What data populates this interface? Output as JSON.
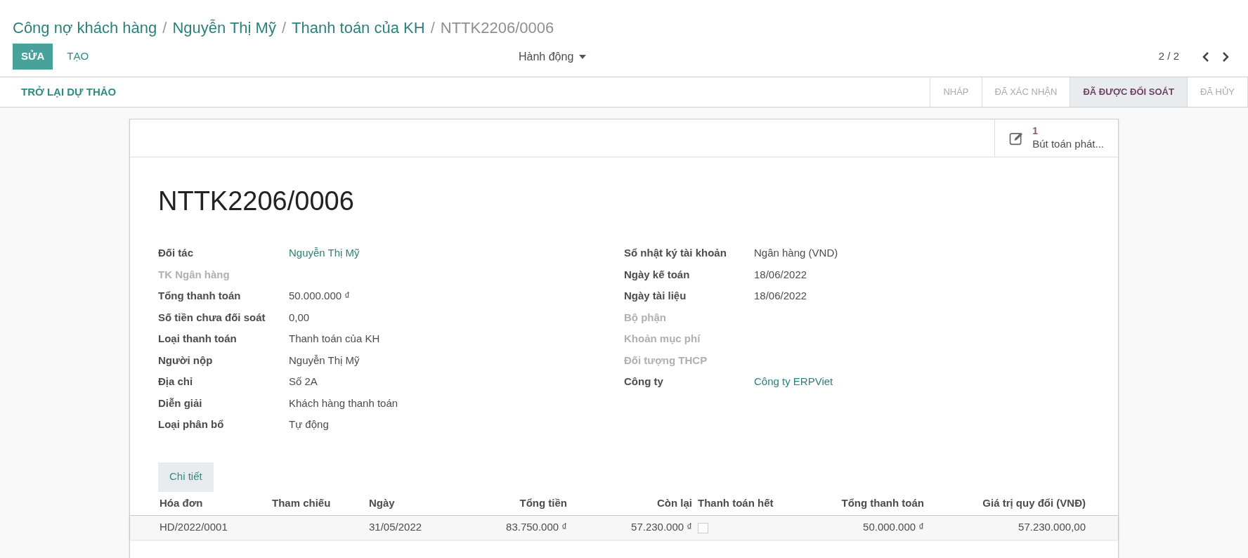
{
  "breadcrumbs": [
    {
      "label": "Công nợ khách hàng",
      "current": false
    },
    {
      "label": "Nguyễn Thị Mỹ",
      "current": false
    },
    {
      "label": "Thanh toán của KH",
      "current": false
    },
    {
      "label": "NTTK2206/0006",
      "current": true
    }
  ],
  "breadcrumb_separator": "/",
  "toolbar": {
    "edit_button": "SỬA",
    "create_button": "TẠO",
    "action_menu": "Hành động",
    "pager": "2 / 2"
  },
  "header": {
    "button": "TRỞ LẠI DỰ THẢO",
    "stages": [
      {
        "label": "NHÁP",
        "selected": false
      },
      {
        "label": "ĐÃ XÁC NHẬN",
        "selected": false
      },
      {
        "label": "ĐÃ ĐƯỢC ĐỐI SOÁT",
        "selected": true
      },
      {
        "label": "ĐÃ HỦY",
        "selected": false
      }
    ]
  },
  "smart_button": {
    "count": "1",
    "label": "Bút toán phát..."
  },
  "title": "NTTK2206/0006",
  "left_fields": [
    {
      "label": "Đối tác",
      "value": "Nguyễn Thị Mỹ",
      "muted": false,
      "link": true
    },
    {
      "label": "TK Ngân hàng",
      "muted": true,
      "link": false
    },
    {
      "label": "Tổng thanh toán",
      "value": "50.000.000 ₫",
      "muted": false,
      "link": false
    },
    {
      "label": "Số tiền chưa đối soát",
      "value": "0,00",
      "muted": false,
      "link": false
    },
    {
      "label": "Loại thanh toán",
      "value": "Thanh toán của KH",
      "muted": false,
      "link": false
    },
    {
      "label": "Người nộp",
      "value": "Nguyễn Thị Mỹ",
      "muted": false,
      "link": false
    },
    {
      "label": "Địa chỉ",
      "value": "Số 2A",
      "muted": false,
      "link": false
    },
    {
      "label": "Diễn giải",
      "value": "Khách hàng thanh toán",
      "muted": false,
      "link": false
    },
    {
      "label": "Loại phân bổ",
      "value": "Tự động",
      "muted": false,
      "link": false
    }
  ],
  "right_fields": [
    {
      "label": "Sổ nhật ký tài khoản",
      "value": "Ngân hàng (VND)",
      "muted": false,
      "link": false
    },
    {
      "label": "Ngày kế toán",
      "value": "18/06/2022",
      "muted": false,
      "link": false
    },
    {
      "label": "Ngày tài liệu",
      "value": "18/06/2022",
      "muted": false,
      "link": false
    },
    {
      "label": "Bộ phận",
      "muted": true,
      "link": false
    },
    {
      "label": "Khoản mục phí",
      "muted": true,
      "link": false
    },
    {
      "label": "Đối tượng THCP",
      "muted": true,
      "link": false
    },
    {
      "label": "Công ty",
      "value": "Công ty ERPViet",
      "muted": false,
      "link": true
    }
  ],
  "tabs": [
    {
      "label": "Chi tiết",
      "selected": true
    }
  ],
  "table": {
    "columns": [
      {
        "label": "Hóa đơn"
      },
      {
        "label": "Tham chiếu"
      },
      {
        "label": "Ngày"
      },
      {
        "label": "Tổng tiền"
      },
      {
        "label": "Còn lại"
      },
      {
        "label": "Thanh toán hết"
      },
      {
        "label": "Tổng thanh toán"
      },
      {
        "label": "Giá trị quy đổi (VNĐ)"
      }
    ],
    "rows": [
      {
        "invoice": "HD/2022/0001",
        "date": "31/05/2022",
        "total": "83.750.000 ₫",
        "remaining": "57.230.000 ₫",
        "paid_full": false,
        "payment": "50.000.000 ₫",
        "converted": "57.230.000,00"
      }
    ]
  }
}
